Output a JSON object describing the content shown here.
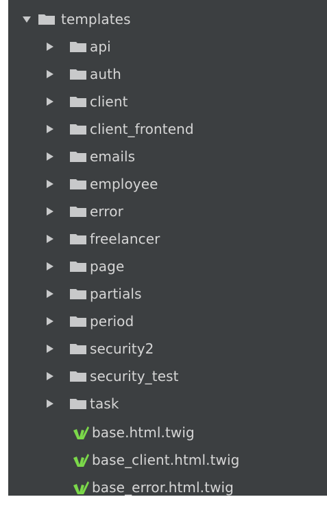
{
  "colors": {
    "panel_bg": "#3c3f41",
    "text": "#d6d6d6",
    "folder": "#c8c9ca",
    "arrow": "#c8c9ca",
    "twig_green": "#7bd84a"
  },
  "tree": {
    "root": {
      "label": "templates",
      "expanded": true,
      "icon": "folder-icon"
    },
    "folders": [
      {
        "label": "api",
        "icon": "folder-icon"
      },
      {
        "label": "auth",
        "icon": "folder-icon"
      },
      {
        "label": "client",
        "icon": "folder-icon"
      },
      {
        "label": "client_frontend",
        "icon": "folder-icon"
      },
      {
        "label": "emails",
        "icon": "folder-icon"
      },
      {
        "label": "employee",
        "icon": "folder-icon"
      },
      {
        "label": "error",
        "icon": "folder-icon"
      },
      {
        "label": "freelancer",
        "icon": "folder-icon"
      },
      {
        "label": "page",
        "icon": "folder-icon"
      },
      {
        "label": "partials",
        "icon": "folder-icon"
      },
      {
        "label": "period",
        "icon": "folder-icon"
      },
      {
        "label": "security2",
        "icon": "folder-icon"
      },
      {
        "label": "security_test",
        "icon": "folder-icon"
      },
      {
        "label": "task",
        "icon": "folder-icon"
      }
    ],
    "files": [
      {
        "label": "base.html.twig",
        "icon": "twig-file-icon"
      },
      {
        "label": "base_client.html.twig",
        "icon": "twig-file-icon"
      },
      {
        "label": "base_error.html.twig",
        "icon": "twig-file-icon"
      }
    ]
  }
}
